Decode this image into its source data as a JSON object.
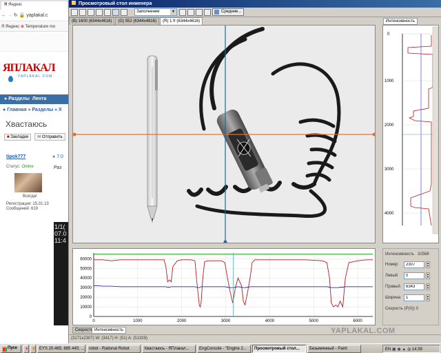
{
  "browser": {
    "tab_title": "Яндекс",
    "address": "yaplakal.c",
    "bookmarks": [
      "Яндекс",
      "Temperature mo"
    ],
    "site_logo": "ЯПЛАКАЛ",
    "site_logo_sub": "YAPLAKAL.COM",
    "nav": [
      "Разделы",
      "Лента"
    ],
    "breadcrumb": [
      "Главная",
      "Разделы",
      "Х"
    ],
    "page_title": "Хвастаюсь",
    "buttons": [
      "Закладки",
      "Отправить"
    ],
    "user_name": "tipok777",
    "status_label": "Статус:",
    "status_value": "Online",
    "avatar_caption": "Всегда!",
    "reg_line": "Регистрация: 15.01.13",
    "msg_line": "Сообщений: 619",
    "post_text": "Раз",
    "rating": "7.0",
    "video_overlay": "1/1( 07.0 11:4"
  },
  "app": {
    "window_title": "Просмотровый стол инженера",
    "fill_mode": "Заполнение",
    "average_button": "Средние...",
    "image_tabs": [
      "(B) 1600 (6344x4616)",
      "(G) 552 (6344x4616)",
      "(R) 1 fr (6344x4616)"
    ],
    "intensity_tab": "Интенсивность",
    "vprofile_ticks": [
      "0",
      "1000",
      "2000",
      "3000",
      "4000"
    ],
    "bottom_tabs": [
      "Скорость",
      "Интенсивность"
    ],
    "status_text": "(3171x2307)    W: (3417) H: (51) A: (51329)",
    "panel": {
      "intensity_label": "Интенсивность",
      "intensity_value": "32568",
      "number_label": "Номер",
      "number_value": "2307",
      "left_label": "Левый",
      "left_value": "0",
      "right_label": "Правый",
      "right_value": "6343",
      "width_label": "Ширина",
      "width_value": "1",
      "speed_label": "Скорость (Р(0))",
      "speed_value": "0"
    }
  },
  "taskbar": {
    "start": "Пуск",
    "tasks": [
      "EYS 20.465; 885 445; ...",
      "robot - Rational Robot",
      "Хвастаюсь - ЯПлакал...",
      "EngConsole - \"Engine 2...",
      "Просмотровый стол...",
      "Безымянный - Paint"
    ],
    "active_task": 4,
    "lang": "EN",
    "clock": "14:39"
  },
  "watermark": "YAPLAKAL.COM",
  "chart_data": {
    "type": "line",
    "x": [
      0,
      100,
      200,
      400,
      600,
      800,
      1000,
      1200,
      1400,
      1600,
      1640,
      1680,
      1720,
      1760,
      1800,
      1900,
      2000,
      2200,
      2300,
      2340,
      2380,
      2400,
      2420,
      2440,
      2480,
      2520,
      2600,
      2800,
      2900,
      2980,
      3040,
      3100,
      3160,
      3220,
      3280,
      3360,
      3400,
      3440,
      3500,
      3560,
      3600,
      3660,
      3720,
      3780,
      3840,
      4000,
      4400,
      4800,
      5200,
      5300,
      5360,
      5400,
      5450,
      5500,
      5550,
      5600,
      5660,
      5720,
      5800,
      6000,
      6200,
      6343
    ],
    "series": [
      {
        "values": [
          59000,
          59000,
          59000,
          58000,
          59000,
          59000,
          59000,
          59000,
          59000,
          59000,
          52000,
          36000,
          38000,
          36000,
          52000,
          58000,
          59000,
          59000,
          58000,
          38000,
          20000,
          12000,
          10000,
          14000,
          40000,
          57000,
          58000,
          58000,
          58000,
          56000,
          40000,
          26000,
          14000,
          30000,
          40000,
          32000,
          16000,
          12000,
          26000,
          42000,
          56000,
          59000,
          59000,
          59000,
          59000,
          59000,
          59000,
          59000,
          58000,
          56000,
          40000,
          14000,
          10000,
          12000,
          10000,
          16000,
          10000,
          40000,
          56000,
          58000,
          59000,
          59000
        ]
      },
      {
        "values": [
          32000,
          32000,
          31500,
          31500,
          31000,
          31000,
          31000,
          31000,
          31000,
          31000,
          31000,
          30500,
          30500,
          31000,
          31000,
          31000,
          31000,
          31000,
          31000,
          30500,
          30000,
          30000,
          30500,
          31000,
          31000,
          31000,
          31000,
          31000,
          31000,
          31000,
          30500,
          30000,
          30000,
          30500,
          31000,
          30500,
          30000,
          30000,
          30500,
          31000,
          31000,
          31000,
          31000,
          31000,
          31000,
          31000,
          31000,
          31000,
          31000,
          31000,
          30500,
          30000,
          30000,
          30000,
          30000,
          30500,
          30500,
          31000,
          31000,
          31000,
          31000,
          31000
        ]
      },
      {
        "values": [
          65000,
          65000,
          65000,
          65000,
          65000,
          65000,
          65000,
          65000,
          65000,
          65000,
          65000,
          65000,
          65000,
          65000,
          65000,
          65000,
          65000,
          65000,
          65000,
          65000,
          65000,
          65000,
          65000,
          65000,
          65000,
          65000,
          65000,
          65000,
          65000,
          65000,
          65000,
          65000,
          65000,
          65000,
          65000,
          65000,
          65000,
          65000,
          65000,
          65000,
          65000,
          65000,
          65000,
          65000,
          65000,
          65000,
          65000,
          65000,
          65000,
          65000,
          65000,
          65000,
          65000,
          65000,
          65000,
          65000,
          65000,
          65000,
          65000,
          65000,
          65000,
          65000
        ]
      }
    ],
    "colors": [
      "#b81818",
      "#2a2ab8",
      "#1a9a1a"
    ],
    "xticks": [
      0,
      1000,
      2000,
      3000,
      4000,
      5000,
      6000
    ],
    "yticks": [
      0,
      10000,
      20000,
      30000,
      40000,
      50000,
      60000
    ],
    "xlim": [
      0,
      6343
    ],
    "ylim": [
      0,
      66000
    ],
    "cursor_x": 3171,
    "grid": true
  }
}
